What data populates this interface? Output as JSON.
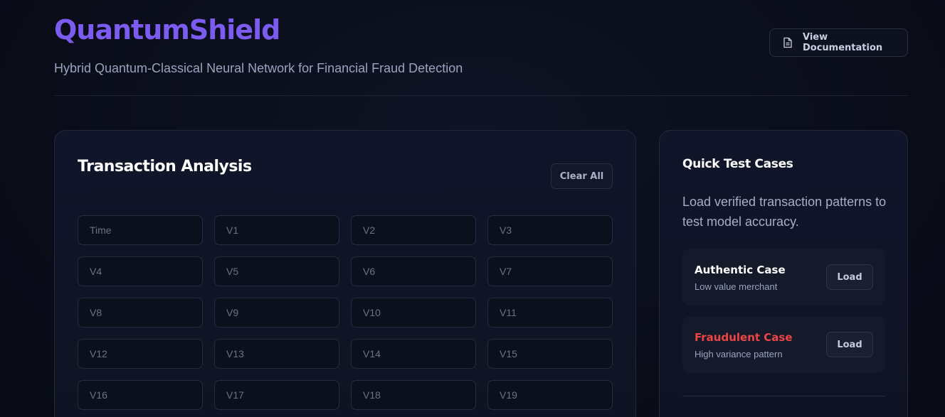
{
  "header": {
    "brand": "QuantumShield",
    "subtitle": "Hybrid Quantum-Classical Neural Network for Financial Fraud Detection",
    "doc_button": {
      "label": "View Documentation",
      "icon": "document-icon"
    }
  },
  "analysis": {
    "title": "Transaction Analysis",
    "clear_label": "Clear All",
    "fields": [
      {
        "placeholder": "Time"
      },
      {
        "placeholder": "V1"
      },
      {
        "placeholder": "V2"
      },
      {
        "placeholder": "V3"
      },
      {
        "placeholder": "V4"
      },
      {
        "placeholder": "V5"
      },
      {
        "placeholder": "V6"
      },
      {
        "placeholder": "V7"
      },
      {
        "placeholder": "V8"
      },
      {
        "placeholder": "V9"
      },
      {
        "placeholder": "V10"
      },
      {
        "placeholder": "V11"
      },
      {
        "placeholder": "V12"
      },
      {
        "placeholder": "V13"
      },
      {
        "placeholder": "V14"
      },
      {
        "placeholder": "V15"
      },
      {
        "placeholder": "V16"
      },
      {
        "placeholder": "V17"
      },
      {
        "placeholder": "V18"
      },
      {
        "placeholder": "V19"
      }
    ]
  },
  "quick_tests": {
    "title": "Quick Test Cases",
    "description": "Load verified transaction patterns to test model accuracy.",
    "cases": [
      {
        "title": "Authentic Case",
        "subtitle": "Low value merchant",
        "button": "Load",
        "title_color": "#ffffff"
      },
      {
        "title": "Fraudulent Case",
        "subtitle": "High variance pattern",
        "button": "Load",
        "title_color": "#ef4444"
      }
    ]
  },
  "colors": {
    "brand": "#7c5cf0",
    "background": "#0a0d1a",
    "danger": "#ef4444"
  }
}
